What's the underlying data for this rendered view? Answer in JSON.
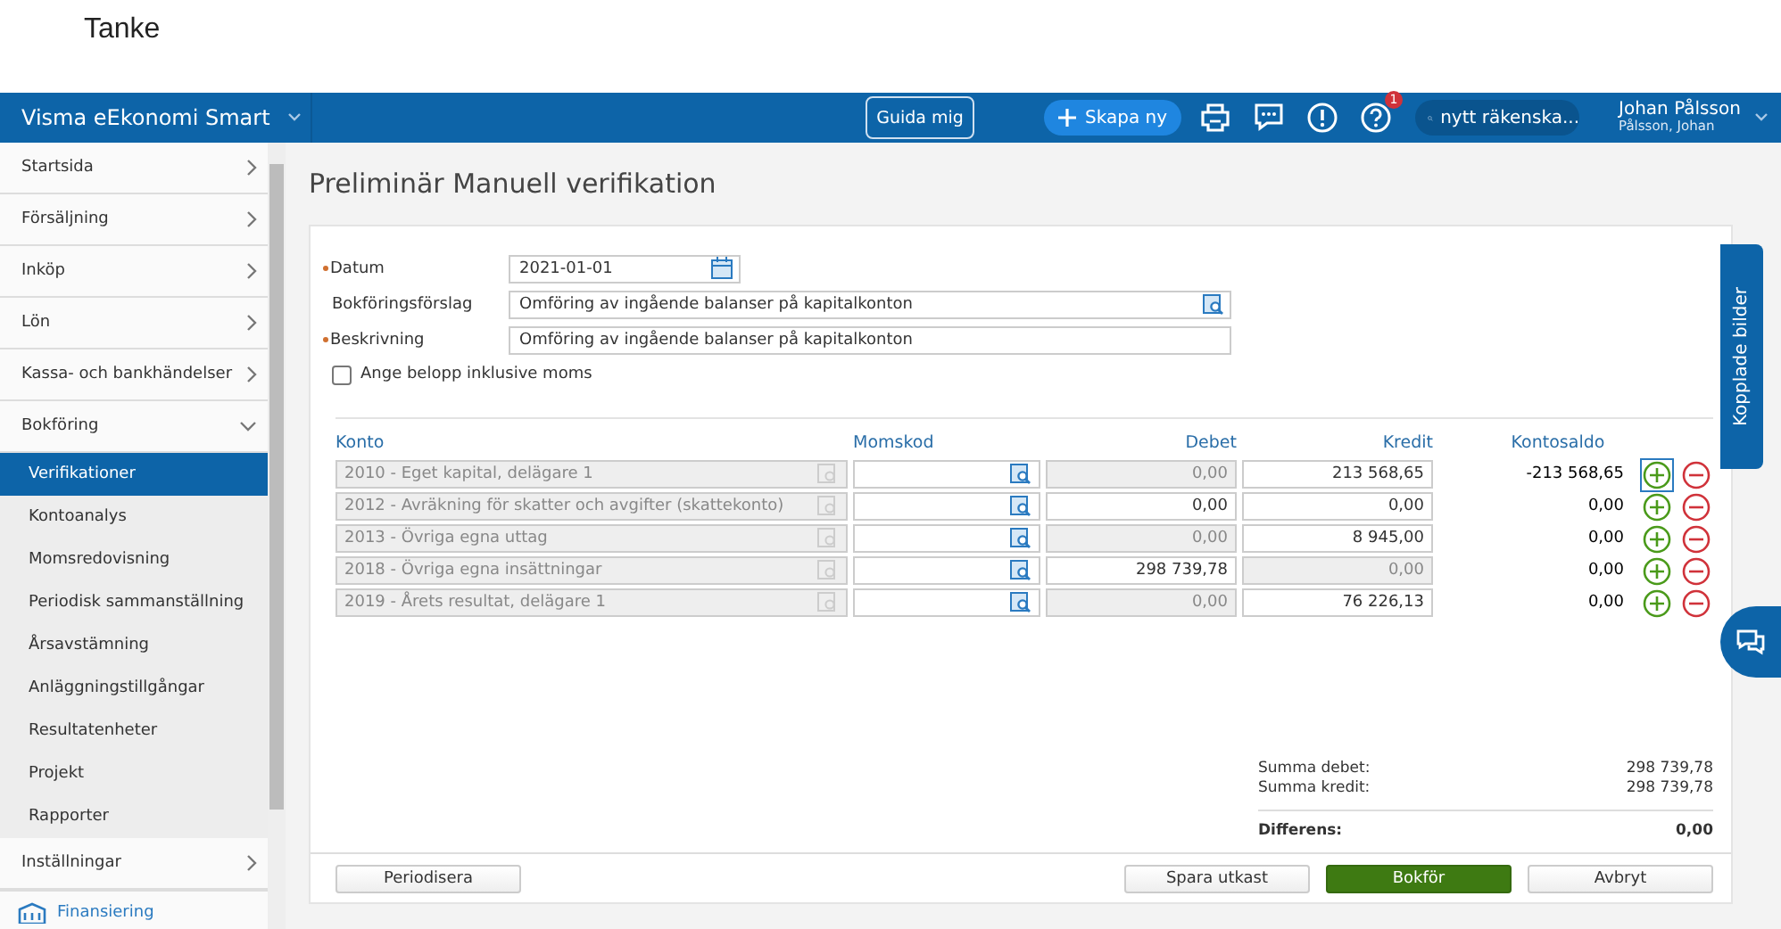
{
  "page_title": "Tanke",
  "topbar": {
    "brand": "Visma eEkonomi Smart",
    "guide_button": "Guida mig",
    "create_button": "Skapa ny",
    "help_badge": "1",
    "search": {
      "value": "nytt räkenska..."
    },
    "user_name": "Johan Pålsson",
    "user_company": "Pålsson, Johan"
  },
  "sidebar": {
    "items": [
      {
        "label": "Startsida",
        "expanded": false
      },
      {
        "label": "Försäljning",
        "expanded": false
      },
      {
        "label": "Inköp",
        "expanded": false
      },
      {
        "label": "Lön",
        "expanded": false
      },
      {
        "label": "Kassa- och bankhändelser",
        "expanded": false
      },
      {
        "label": "Bokföring",
        "expanded": true,
        "children": [
          {
            "label": "Verifikationer",
            "selected": true
          },
          {
            "label": "Kontoanalys",
            "selected": false
          },
          {
            "label": "Momsredovisning",
            "selected": false
          },
          {
            "label": "Periodisk sammanställning",
            "selected": false
          },
          {
            "label": "Årsavstämning",
            "selected": false
          },
          {
            "label": "Anläggningstillgångar",
            "selected": false
          },
          {
            "label": "Resultatenheter",
            "selected": false
          },
          {
            "label": "Projekt",
            "selected": false
          },
          {
            "label": "Rapporter",
            "selected": false
          }
        ]
      },
      {
        "label": "Inställningar",
        "expanded": false
      }
    ],
    "footer_link": "Finansiering"
  },
  "title": "Preliminär Manuell verifikation",
  "form": {
    "date_label": "Datum",
    "date_required": true,
    "date_value": "2021-01-01",
    "suggestion_label": "Bokföringsförslag",
    "suggestion_value": "Omföring av ingående balanser på kapitalkonton",
    "description_label": "Beskrivning",
    "description_required": true,
    "description_value": "Omföring av ingående balanser på kapitalkonton",
    "vat_checkbox": {
      "label": "Ange belopp inklusive moms",
      "checked": false
    }
  },
  "table": {
    "columns": [
      "Konto",
      "Momskod",
      "Debet",
      "Kredit",
      "Kontosaldo"
    ],
    "rows": [
      {
        "account": "2010 - Eget kapital, delägare 1",
        "debet": {
          "value": "0,00",
          "disabled": true
        },
        "kredit": {
          "value": "213 568,65",
          "disabled": false
        },
        "saldo": "-213 568,65",
        "focused": true
      },
      {
        "account": "2012 - Avräkning för skatter och avgifter (skattekonto)",
        "debet": {
          "value": "0,00",
          "disabled": false
        },
        "kredit": {
          "value": "0,00",
          "disabled": false
        },
        "saldo": "0,00",
        "focused": false
      },
      {
        "account": "2013 - Övriga egna uttag",
        "debet": {
          "value": "0,00",
          "disabled": true
        },
        "kredit": {
          "value": "8 945,00",
          "disabled": false
        },
        "saldo": "0,00",
        "focused": false
      },
      {
        "account": "2018 - Övriga egna insättningar",
        "debet": {
          "value": "298 739,78",
          "disabled": false
        },
        "kredit": {
          "value": "0,00",
          "disabled": true
        },
        "saldo": "0,00",
        "focused": false
      },
      {
        "account": "2019 - Årets resultat, delägare 1",
        "debet": {
          "value": "0,00",
          "disabled": true
        },
        "kredit": {
          "value": "76 226,13",
          "disabled": false
        },
        "saldo": "0,00",
        "focused": false
      }
    ]
  },
  "summary": [
    {
      "label": "Summa debet:",
      "value": "298 739,78",
      "kind": "sum"
    },
    {
      "label": "Summa kredit:",
      "value": "298 739,78",
      "kind": "sum"
    },
    {
      "label": "Differens:",
      "value": "0,00",
      "kind": "total"
    }
  ],
  "buttons": {
    "periodize": "Periodisera",
    "save_draft": "Spara utkast",
    "book": "Bokför",
    "cancel": "Avbryt"
  },
  "side_tab": "Kopplade bilder"
}
